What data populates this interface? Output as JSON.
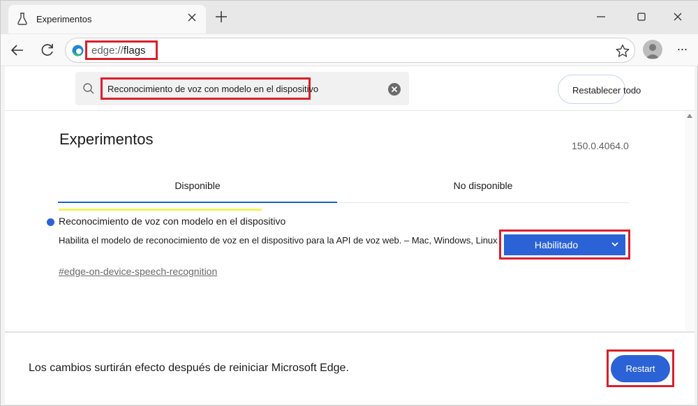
{
  "browser": {
    "tab_title": "Experimentos",
    "url_scheme": "edge://",
    "url_path": "flags"
  },
  "search": {
    "value": "Reconocimiento de voz con modelo en el dispositivo",
    "reset_label": "Restablecer todo"
  },
  "page": {
    "title": "Experimentos",
    "version": "150.0.4064.0",
    "tabs": [
      {
        "label": "Disponible",
        "selected": true
      },
      {
        "label": "No disponible",
        "selected": false
      }
    ]
  },
  "flag": {
    "title": "Reconocimiento de voz con modelo en el dispositivo",
    "description": "Habilita el modelo de reconocimiento de voz en el dispositivo para la API de voz web. – Mac, Windows, Linux",
    "link": "#edge-on-device-speech-recognition",
    "state": "Habilitado"
  },
  "footer": {
    "message": "Los cambios surtirán efecto después de reiniciar Microsoft Edge.",
    "restart_label": "Restart"
  },
  "colors": {
    "accent": "#2b63d6",
    "highlight_box": "#d8202b",
    "search_highlight": "#f2f25a"
  },
  "icons": [
    "beaker-icon",
    "close-icon",
    "plus-icon",
    "minimize-icon",
    "maximize-icon",
    "back-icon",
    "refresh-icon",
    "edge-logo-icon",
    "star-icon",
    "avatar-icon",
    "more-icon",
    "search-icon",
    "clear-icon",
    "chevron-down-icon"
  ]
}
